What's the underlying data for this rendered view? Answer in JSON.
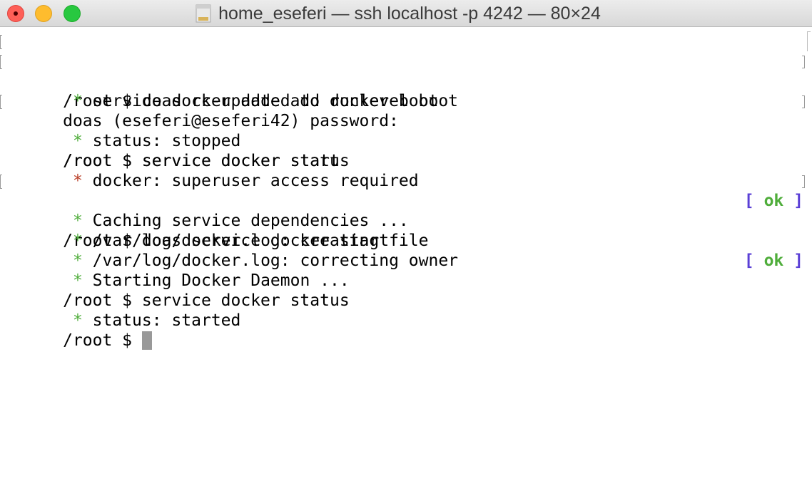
{
  "window": {
    "title": "home_eseferi — ssh localhost -p 4242 — 80×24",
    "title_icon": "document-icon"
  },
  "colors": {
    "bullet_ok": "#4fad3b",
    "bullet_err": "#b83c25",
    "ok_bracket": "#5a3fd6",
    "ok_word": "#4fad3b",
    "cursor": "#999999"
  },
  "terminal": {
    "lines": [
      {
        "prompt": "/root $ ",
        "text": "doas rc-update add docker boot"
      },
      {
        "text": "doas (eseferi@eseferi42) password:"
      },
      {
        "bullet": "*",
        "text": "service docker added to runlevel boot"
      },
      {
        "prompt": "/root $ ",
        "text": "service docker status"
      },
      {
        "bullet": "*",
        "text": "status: stopped"
      },
      {
        "prompt": "/root $ ",
        "text": "service docker start"
      },
      {
        "bullet": "*",
        "text": "docker: superuser access required"
      },
      {
        "prompt": "/root $ ",
        "text": "doas service docker start"
      },
      {
        "bullet": "*",
        "text": "Caching service dependencies ...",
        "ok_open": "[",
        "ok": "ok",
        "ok_close": "]"
      },
      {
        "bullet": "*",
        "text": "/var/log/docker.log: creating file"
      },
      {
        "bullet": "*",
        "text": "/var/log/docker.log: correcting owner"
      },
      {
        "bullet": "*",
        "text": "Starting Docker Daemon ...",
        "ok_open": "[",
        "ok": "ok",
        "ok_close": "]"
      },
      {
        "prompt": "/root $ ",
        "text": "service docker status"
      },
      {
        "bullet": "*",
        "text": "status: started"
      },
      {
        "prompt": "/root $ ",
        "text": ""
      }
    ]
  }
}
